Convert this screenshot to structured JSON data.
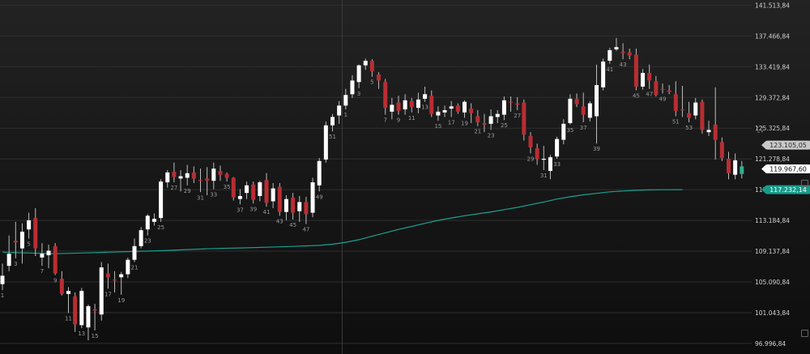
{
  "chart_data": {
    "type": "candlestick",
    "ylim": [
      95600,
      142200
    ],
    "y_ticks": [
      "141.513,84",
      "137.466,84",
      "133.419,84",
      "129.372,84",
      "125.325,84",
      "121.278,84",
      "117.231,84",
      "113.184,84",
      "109.137,84",
      "105.090,84",
      "101.043,84",
      "96.996,84"
    ],
    "y_tick_values": [
      141513.84,
      137466.84,
      133419.84,
      129372.84,
      125325.84,
      121278.84,
      117231.84,
      113184.84,
      109137.84,
      105090.84,
      101043.84,
      96996.84
    ],
    "candles": [
      {
        "o": 104800,
        "h": 107500,
        "l": 104000,
        "c": 105900
      },
      {
        "o": 107200,
        "h": 111200,
        "l": 106500,
        "c": 108800
      },
      {
        "o": 110500,
        "h": 113000,
        "l": 108200,
        "c": 110300
      },
      {
        "o": 109500,
        "h": 112800,
        "l": 107500,
        "c": 111700
      },
      {
        "o": 112000,
        "h": 114200,
        "l": 110800,
        "c": 113200
      },
      {
        "o": 113500,
        "h": 114800,
        "l": 108500,
        "c": 109500
      },
      {
        "o": 108300,
        "h": 110200,
        "l": 107200,
        "c": 108800
      },
      {
        "o": 108600,
        "h": 110000,
        "l": 106900,
        "c": 109200
      },
      {
        "o": 109800,
        "h": 110200,
        "l": 106000,
        "c": 106200
      },
      {
        "o": 105500,
        "h": 106500,
        "l": 103300,
        "c": 103500
      },
      {
        "o": 103500,
        "h": 104400,
        "l": 101000,
        "c": 103900
      },
      {
        "o": 103200,
        "h": 103700,
        "l": 98500,
        "c": 99500
      },
      {
        "o": 99400,
        "h": 104300,
        "l": 99000,
        "c": 103900
      },
      {
        "o": 99100,
        "h": 102100,
        "l": 97400,
        "c": 101900
      },
      {
        "o": 101500,
        "h": 102200,
        "l": 98700,
        "c": 101300
      },
      {
        "o": 100800,
        "h": 107700,
        "l": 100000,
        "c": 107000
      },
      {
        "o": 106200,
        "h": 107500,
        "l": 104200,
        "c": 105700
      },
      {
        "o": 105400,
        "h": 106500,
        "l": 103700,
        "c": 105300
      },
      {
        "o": 105700,
        "h": 106400,
        "l": 103400,
        "c": 106100
      },
      {
        "o": 106100,
        "h": 108300,
        "l": 105600,
        "c": 108000
      },
      {
        "o": 108000,
        "h": 110800,
        "l": 107700,
        "c": 109800
      },
      {
        "o": 109800,
        "h": 112300,
        "l": 109500,
        "c": 111900
      },
      {
        "o": 112000,
        "h": 114000,
        "l": 111200,
        "c": 113800
      },
      {
        "o": 113000,
        "h": 114100,
        "l": 112500,
        "c": 113400
      },
      {
        "o": 113500,
        "h": 118600,
        "l": 113000,
        "c": 118300
      },
      {
        "o": 118200,
        "h": 119800,
        "l": 117500,
        "c": 119500
      },
      {
        "o": 119600,
        "h": 120800,
        "l": 118200,
        "c": 118900
      },
      {
        "o": 118700,
        "h": 119800,
        "l": 117000,
        "c": 119000
      },
      {
        "o": 118800,
        "h": 120500,
        "l": 117800,
        "c": 119400
      },
      {
        "o": 119500,
        "h": 120300,
        "l": 118100,
        "c": 118700
      },
      {
        "o": 118500,
        "h": 120000,
        "l": 116900,
        "c": 118400
      },
      {
        "o": 118700,
        "h": 120200,
        "l": 116500,
        "c": 118400
      },
      {
        "o": 118400,
        "h": 120800,
        "l": 117300,
        "c": 120000
      },
      {
        "o": 119700,
        "h": 120400,
        "l": 118400,
        "c": 119200
      },
      {
        "o": 119300,
        "h": 119500,
        "l": 118300,
        "c": 118800
      },
      {
        "o": 118800,
        "h": 118900,
        "l": 115800,
        "c": 116200
      },
      {
        "o": 116000,
        "h": 117300,
        "l": 115300,
        "c": 116400
      },
      {
        "o": 116800,
        "h": 118300,
        "l": 116000,
        "c": 117800
      },
      {
        "o": 117900,
        "h": 118300,
        "l": 115400,
        "c": 115900
      },
      {
        "o": 116400,
        "h": 118400,
        "l": 115700,
        "c": 118200
      },
      {
        "o": 118500,
        "h": 119400,
        "l": 115000,
        "c": 115500
      },
      {
        "o": 115700,
        "h": 118100,
        "l": 114800,
        "c": 117400
      },
      {
        "o": 117600,
        "h": 118100,
        "l": 113800,
        "c": 114300
      },
      {
        "o": 114300,
        "h": 116500,
        "l": 113200,
        "c": 116000
      },
      {
        "o": 116200,
        "h": 116800,
        "l": 113300,
        "c": 114200
      },
      {
        "o": 114400,
        "h": 116400,
        "l": 113000,
        "c": 115600
      },
      {
        "o": 115600,
        "h": 116300,
        "l": 112700,
        "c": 114000
      },
      {
        "o": 114200,
        "h": 118800,
        "l": 113600,
        "c": 118200
      },
      {
        "o": 117800,
        "h": 121400,
        "l": 117000,
        "c": 121000
      },
      {
        "o": 121200,
        "h": 126200,
        "l": 120800,
        "c": 125700
      },
      {
        "o": 125700,
        "h": 127200,
        "l": 124900,
        "c": 126800
      },
      {
        "o": 127000,
        "h": 128900,
        "l": 125900,
        "c": 128300
      },
      {
        "o": 128300,
        "h": 130500,
        "l": 127800,
        "c": 129700
      },
      {
        "o": 129800,
        "h": 132300,
        "l": 129300,
        "c": 131600
      },
      {
        "o": 131400,
        "h": 133700,
        "l": 130600,
        "c": 133600
      },
      {
        "o": 133600,
        "h": 134500,
        "l": 133000,
        "c": 134200
      },
      {
        "o": 134200,
        "h": 134400,
        "l": 132100,
        "c": 132800
      },
      {
        "o": 132400,
        "h": 132700,
        "l": 130500,
        "c": 131600
      },
      {
        "o": 131400,
        "h": 131800,
        "l": 127100,
        "c": 128000
      },
      {
        "o": 127500,
        "h": 129300,
        "l": 126500,
        "c": 128400
      },
      {
        "o": 128700,
        "h": 129600,
        "l": 127100,
        "c": 127600
      },
      {
        "o": 127800,
        "h": 129800,
        "l": 127100,
        "c": 129000
      },
      {
        "o": 128900,
        "h": 129300,
        "l": 127400,
        "c": 128100
      },
      {
        "o": 128000,
        "h": 130000,
        "l": 127300,
        "c": 129100
      },
      {
        "o": 129200,
        "h": 130800,
        "l": 128800,
        "c": 129800
      },
      {
        "o": 129600,
        "h": 130300,
        "l": 126800,
        "c": 127200
      },
      {
        "o": 127000,
        "h": 128200,
        "l": 126300,
        "c": 127500
      },
      {
        "o": 127400,
        "h": 128300,
        "l": 126800,
        "c": 127700
      },
      {
        "o": 127900,
        "h": 128900,
        "l": 126800,
        "c": 128200
      },
      {
        "o": 128300,
        "h": 128600,
        "l": 127200,
        "c": 127500
      },
      {
        "o": 127400,
        "h": 129000,
        "l": 126700,
        "c": 128800
      },
      {
        "o": 127900,
        "h": 128600,
        "l": 126000,
        "c": 127300
      },
      {
        "o": 126900,
        "h": 127700,
        "l": 125600,
        "c": 126100
      },
      {
        "o": 126000,
        "h": 127200,
        "l": 124800,
        "c": 125800
      },
      {
        "o": 125900,
        "h": 127800,
        "l": 125100,
        "c": 126900
      },
      {
        "o": 126800,
        "h": 127700,
        "l": 126000,
        "c": 127200
      },
      {
        "o": 127100,
        "h": 129500,
        "l": 126400,
        "c": 129000
      },
      {
        "o": 128800,
        "h": 129500,
        "l": 127500,
        "c": 128700
      },
      {
        "o": 128600,
        "h": 129400,
        "l": 127700,
        "c": 128400
      },
      {
        "o": 128700,
        "h": 129100,
        "l": 123700,
        "c": 124500
      },
      {
        "o": 124300,
        "h": 124800,
        "l": 122000,
        "c": 122800
      },
      {
        "o": 122700,
        "h": 123300,
        "l": 120500,
        "c": 121300
      },
      {
        "o": 121200,
        "h": 123000,
        "l": 119800,
        "c": 121300
      },
      {
        "o": 119700,
        "h": 121800,
        "l": 118600,
        "c": 121500
      },
      {
        "o": 121600,
        "h": 124200,
        "l": 121300,
        "c": 123900
      },
      {
        "o": 123800,
        "h": 126500,
        "l": 123200,
        "c": 125900
      },
      {
        "o": 126000,
        "h": 129800,
        "l": 125800,
        "c": 129200
      },
      {
        "o": 129200,
        "h": 129900,
        "l": 128100,
        "c": 128500
      },
      {
        "o": 128200,
        "h": 130000,
        "l": 126100,
        "c": 127100
      },
      {
        "o": 126700,
        "h": 128900,
        "l": 126200,
        "c": 128600
      },
      {
        "o": 126900,
        "h": 133700,
        "l": 123300,
        "c": 131000
      },
      {
        "o": 130700,
        "h": 134500,
        "l": 130300,
        "c": 134100
      },
      {
        "o": 134200,
        "h": 135900,
        "l": 133800,
        "c": 135600
      },
      {
        "o": 135700,
        "h": 137200,
        "l": 135500,
        "c": 136000
      },
      {
        "o": 135400,
        "h": 136500,
        "l": 134400,
        "c": 135200
      },
      {
        "o": 135300,
        "h": 135800,
        "l": 134400,
        "c": 134900
      },
      {
        "o": 135000,
        "h": 135800,
        "l": 130300,
        "c": 130800
      },
      {
        "o": 130800,
        "h": 133100,
        "l": 130400,
        "c": 132600
      },
      {
        "o": 132600,
        "h": 133700,
        "l": 130500,
        "c": 131600
      },
      {
        "o": 131500,
        "h": 132200,
        "l": 129500,
        "c": 129700
      },
      {
        "o": 130500,
        "h": 131200,
        "l": 129900,
        "c": 130400
      },
      {
        "o": 130300,
        "h": 131000,
        "l": 129800,
        "c": 130100
      },
      {
        "o": 129800,
        "h": 131500,
        "l": 126900,
        "c": 127600
      },
      {
        "o": 127800,
        "h": 130900,
        "l": 126800,
        "c": 127700
      },
      {
        "o": 127300,
        "h": 128800,
        "l": 126100,
        "c": 126700
      },
      {
        "o": 127000,
        "h": 129300,
        "l": 126500,
        "c": 128700
      },
      {
        "o": 128800,
        "h": 129100,
        "l": 124600,
        "c": 125100
      },
      {
        "o": 124800,
        "h": 126300,
        "l": 124300,
        "c": 125100
      },
      {
        "o": 125800,
        "h": 130700,
        "l": 121200,
        "c": 123800
      },
      {
        "o": 123500,
        "h": 124100,
        "l": 121000,
        "c": 121400
      },
      {
        "o": 121300,
        "h": 122200,
        "l": 118600,
        "c": 119400
      },
      {
        "o": 119200,
        "h": 122000,
        "l": 118600,
        "c": 121100
      },
      {
        "o": 119300,
        "h": 121000,
        "l": 118700,
        "c": 120300
      }
    ],
    "candle_labels": [
      {
        "i": 0,
        "t": "1"
      },
      {
        "i": 2,
        "t": "3"
      },
      {
        "i": 4,
        "t": "5"
      },
      {
        "i": 6,
        "t": "7"
      },
      {
        "i": 8,
        "t": "9"
      },
      {
        "i": 10,
        "t": "11"
      },
      {
        "i": 12,
        "t": "13"
      },
      {
        "i": 14,
        "t": "15"
      },
      {
        "i": 16,
        "t": "17"
      },
      {
        "i": 18,
        "t": "19"
      },
      {
        "i": 20,
        "t": "21"
      },
      {
        "i": 22,
        "t": "23"
      },
      {
        "i": 24,
        "t": "25"
      },
      {
        "i": 26,
        "t": "27"
      },
      {
        "i": 28,
        "t": "29"
      },
      {
        "i": 30,
        "t": "31"
      },
      {
        "i": 32,
        "t": "33"
      },
      {
        "i": 34,
        "t": "35"
      },
      {
        "i": 36,
        "t": "37"
      },
      {
        "i": 38,
        "t": "39"
      },
      {
        "i": 40,
        "t": "41"
      },
      {
        "i": 42,
        "t": "43"
      },
      {
        "i": 44,
        "t": "45"
      },
      {
        "i": 46,
        "t": "47"
      },
      {
        "i": 48,
        "t": "49"
      },
      {
        "i": 50,
        "t": "51"
      },
      {
        "i": 52,
        "t": "1"
      },
      {
        "i": 54,
        "t": "3"
      },
      {
        "i": 56,
        "t": "5"
      },
      {
        "i": 58,
        "t": "7"
      },
      {
        "i": 60,
        "t": "9"
      },
      {
        "i": 62,
        "t": "11"
      },
      {
        "i": 64,
        "t": "13"
      },
      {
        "i": 66,
        "t": "15"
      },
      {
        "i": 68,
        "t": "17"
      },
      {
        "i": 70,
        "t": "19"
      },
      {
        "i": 72,
        "t": "21"
      },
      {
        "i": 74,
        "t": "23"
      },
      {
        "i": 76,
        "t": "25"
      },
      {
        "i": 78,
        "t": "27"
      },
      {
        "i": 80,
        "t": "29"
      },
      {
        "i": 82,
        "t": "31"
      },
      {
        "i": 84,
        "t": "33"
      },
      {
        "i": 86,
        "t": "35"
      },
      {
        "i": 88,
        "t": "37"
      },
      {
        "i": 90,
        "t": "39"
      },
      {
        "i": 92,
        "t": "41"
      },
      {
        "i": 94,
        "t": "43"
      },
      {
        "i": 96,
        "t": "45"
      },
      {
        "i": 98,
        "t": "47"
      },
      {
        "i": 100,
        "t": "49"
      },
      {
        "i": 102,
        "t": "51"
      },
      {
        "i": 104,
        "t": "53"
      }
    ],
    "moving_average": [
      [
        0,
        109000
      ],
      [
        4,
        108900
      ],
      [
        8,
        108800
      ],
      [
        12,
        108900
      ],
      [
        16,
        109000
      ],
      [
        20,
        109100
      ],
      [
        24,
        109200
      ],
      [
        28,
        109350
      ],
      [
        32,
        109480
      ],
      [
        36,
        109560
      ],
      [
        40,
        109650
      ],
      [
        44,
        109760
      ],
      [
        48,
        109900
      ],
      [
        50,
        110050
      ],
      [
        52,
        110300
      ],
      [
        54,
        110650
      ],
      [
        56,
        111100
      ],
      [
        58,
        111550
      ],
      [
        60,
        112000
      ],
      [
        62,
        112400
      ],
      [
        64,
        112800
      ],
      [
        66,
        113200
      ],
      [
        68,
        113500
      ],
      [
        70,
        113800
      ],
      [
        72,
        114050
      ],
      [
        74,
        114300
      ],
      [
        76,
        114600
      ],
      [
        78,
        114900
      ],
      [
        80,
        115250
      ],
      [
        82,
        115600
      ],
      [
        84,
        116000
      ],
      [
        86,
        116300
      ],
      [
        88,
        116550
      ],
      [
        90,
        116750
      ],
      [
        92,
        116950
      ],
      [
        94,
        117050
      ],
      [
        96,
        117150
      ],
      [
        98,
        117200
      ],
      [
        100,
        117230
      ],
      [
        103,
        117232.14
      ]
    ],
    "badges": [
      {
        "label": "123.105,05",
        "value": 123105.05,
        "bg": "#c8c8c8",
        "fg": "#2a2a2a"
      },
      {
        "label": "119.967,60",
        "value": 119967.6,
        "bg": "#ffffff",
        "fg": "#111111"
      },
      {
        "label": "117.232,14",
        "value": 117232.14,
        "bg": "#1a9b89",
        "fg": "#ffffff"
      }
    ],
    "colors": {
      "up_fill": "#ffffff",
      "up_last": "#2fae90",
      "down_fill": "#b92d32",
      "wick": "#bcbcbc",
      "ma": "#1aa191",
      "grid": "#2f2f2f",
      "divider": "#3a3a3a"
    }
  },
  "icons": {
    "crosshair": "crosshair-icon"
  }
}
